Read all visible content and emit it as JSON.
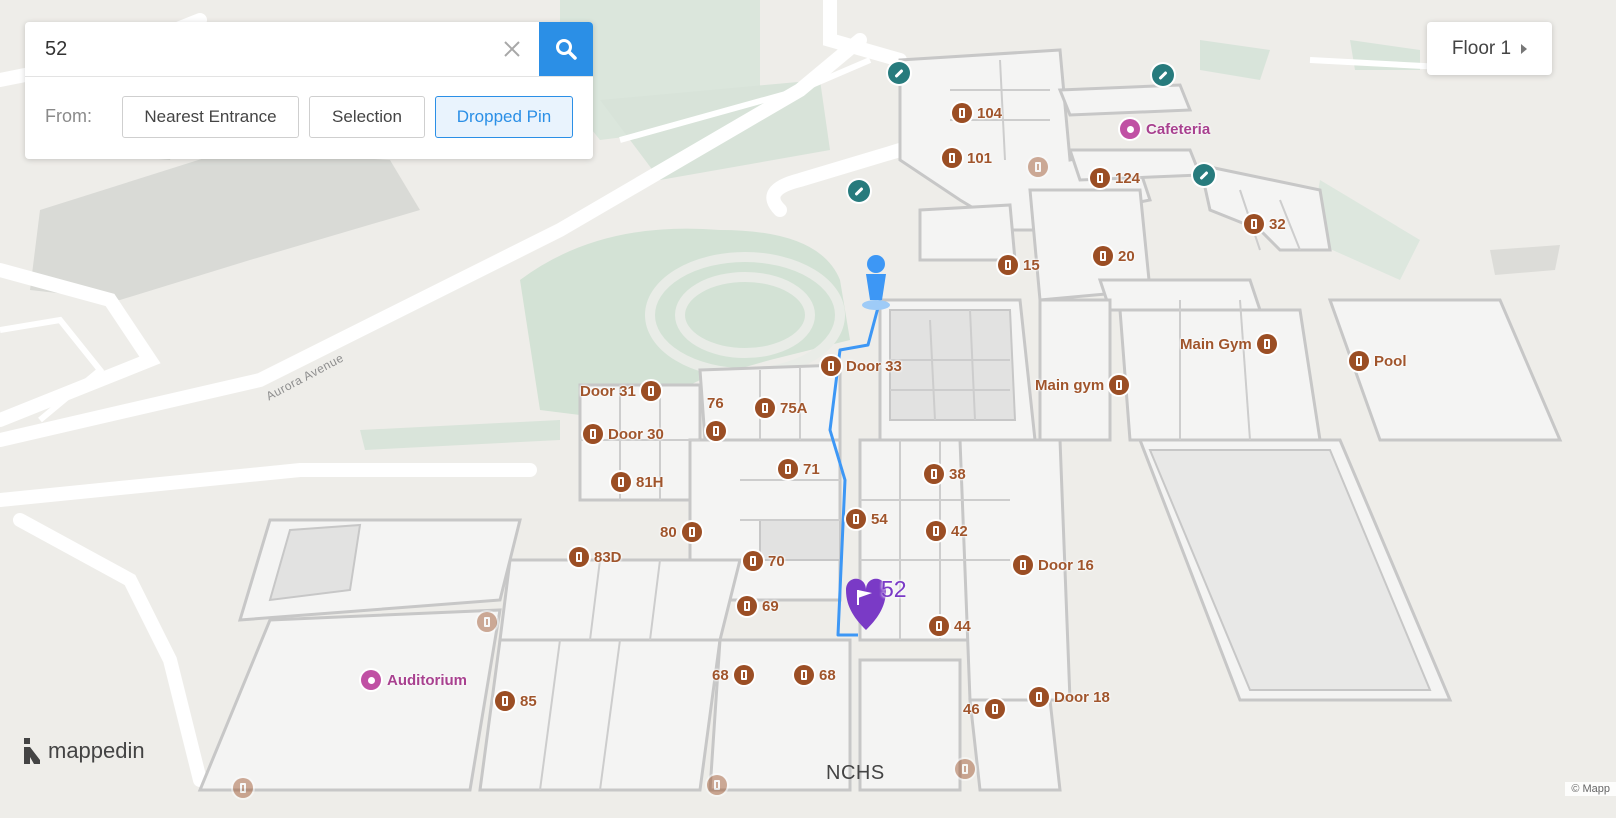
{
  "search": {
    "value": "52",
    "placeholder": "",
    "clear_icon": "close-icon",
    "search_icon": "search-icon"
  },
  "from": {
    "label": "From:",
    "options": [
      "Nearest Entrance",
      "Selection",
      "Dropped Pin"
    ],
    "selected": "Dropped Pin"
  },
  "floor": {
    "label": "Floor 1",
    "icon": "chevron-right-icon"
  },
  "map": {
    "street": "Aurora Avenue",
    "building": "NCHS",
    "destination": "52",
    "amenities": [
      "Cafeteria",
      "Auditorium"
    ],
    "doors": {
      "d104": "104",
      "d101": "101",
      "d124": "124",
      "d32": "32",
      "d15": "15",
      "d20": "20",
      "door33": "Door 33",
      "mainGym": "Main Gym",
      "pool": "Pool",
      "mainGym2": "Main gym",
      "door31": "Door 31",
      "d76": "76",
      "d75a": "75A",
      "door30": "Door 30",
      "d71": "71",
      "d38": "38",
      "d81h": "81H",
      "d54": "54",
      "d42": "42",
      "d80": "80",
      "d83d": "83D",
      "d70": "70",
      "door16": "Door 16",
      "d69": "69",
      "d44": "44",
      "d68a": "68",
      "d68b": "68",
      "door18": "Door 18",
      "d85": "85",
      "d46": "46"
    },
    "colors": {
      "route": "#3d97f5",
      "door": "#9b4e24",
      "destination": "#7a3ac6",
      "amenity": "#c050a4",
      "ramp": "#277b7d"
    }
  },
  "branding": {
    "logo": "mappedin",
    "attribution": "© Mapp"
  }
}
